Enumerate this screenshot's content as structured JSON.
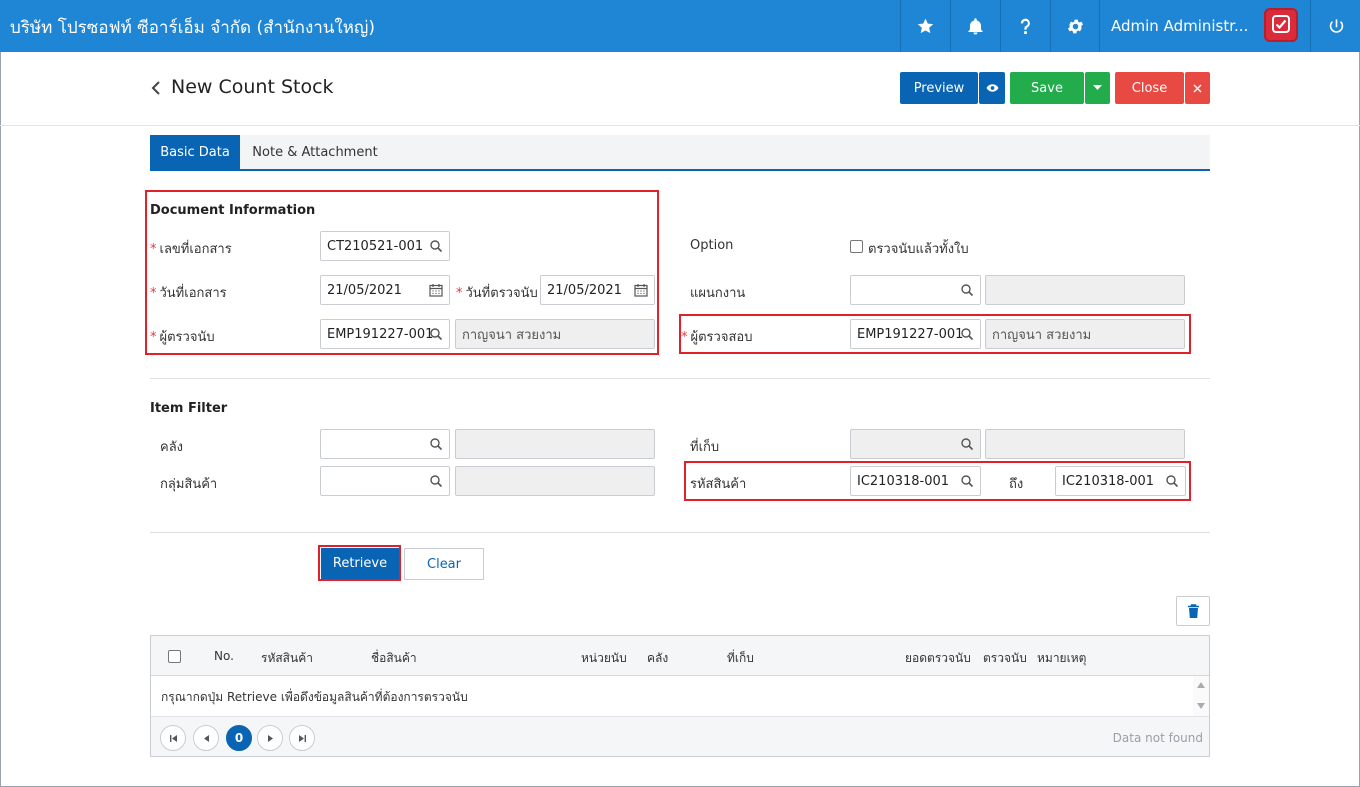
{
  "header": {
    "company": "บริษัท โปรซอฟท์ ซีอาร์เอ็ม จำกัด (สำนักงานใหญ่)",
    "user_name": "Admin Administr..."
  },
  "page": {
    "title": "New Count Stock",
    "preview_label": "Preview",
    "save_label": "Save",
    "close_label": "Close"
  },
  "tabs": [
    {
      "label": "Basic Data"
    },
    {
      "label": "Note & Attachment"
    }
  ],
  "document_info": {
    "heading": "Document Information",
    "doc_no_label": "เลขที่เอกสาร",
    "doc_no_value": "CT210521-001",
    "doc_date_label": "วันที่เอกสาร",
    "doc_date_value": "21/05/2021",
    "count_date_label": "วันที่ตรวจนับ",
    "count_date_value": "21/05/2021",
    "counter_label": "ผู้ตรวจนับ",
    "counter_code": "EMP191227-001",
    "counter_name": "กาญจนา สวยงาม",
    "option_label": "Option",
    "option_checkbox_label": "ตรวจนับแล้วทั้งใบ",
    "plan_label": "แผนกงาน",
    "plan_value": "",
    "plan_name": "",
    "checker_label": "ผู้ตรวจสอบ",
    "checker_code": "EMP191227-001",
    "checker_name": "กาญจนา สวยงาม"
  },
  "item_filter": {
    "heading": "Item Filter",
    "warehouse_label": "คลัง",
    "warehouse_value": "",
    "location_label": "ที่เก็บ",
    "location_value": "",
    "group_label": "กลุ่มสินค้า",
    "group_value": "",
    "item_code_label": "รหัสสินค้า",
    "item_code_from": "IC210318-001",
    "to_label": "ถึง",
    "item_code_to": "IC210318-001"
  },
  "actions": {
    "retrieve_label": "Retrieve",
    "clear_label": "Clear"
  },
  "grid": {
    "columns": [
      "No.",
      "รหัสสินค้า",
      "ชื่อสินค้า",
      "หน่วยนับ",
      "คลัง",
      "ที่เก็บ",
      "ยอดตรวจนับ",
      "ตรวจนับ",
      "หมายเหตุ"
    ],
    "empty_message": "กรุณากดปุ่ม Retrieve เพื่อดึงข้อมูลสินค้าที่ต้องการตรวจนับ",
    "current_page": "0",
    "status": "Data not found"
  },
  "colors": {
    "header_blue": "#1f86d6",
    "primary": "#0a64b4",
    "save_green": "#22ac4b",
    "close_red": "#e84a43",
    "highlight_red": "#e0202b"
  }
}
